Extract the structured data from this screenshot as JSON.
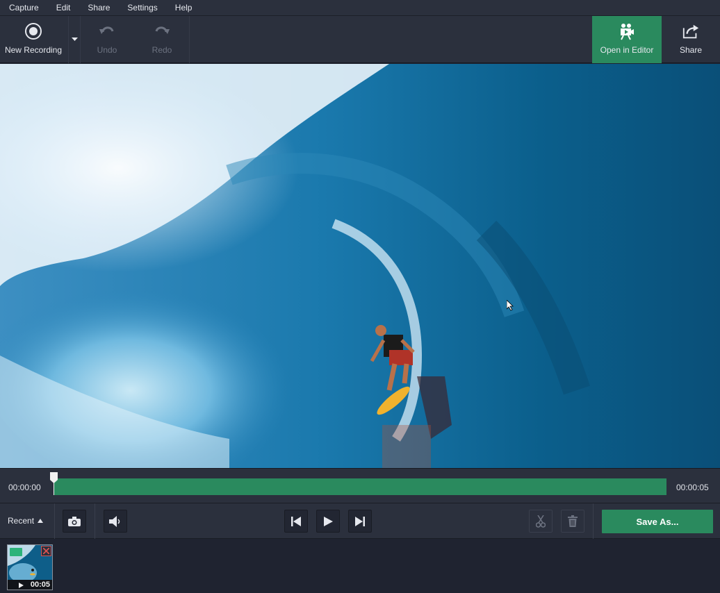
{
  "menu": [
    "Capture",
    "Edit",
    "Share",
    "Settings",
    "Help"
  ],
  "toolbar": {
    "new_recording": "New Recording",
    "undo": "Undo",
    "redo": "Redo",
    "open_in_editor": "Open in Editor",
    "share": "Share"
  },
  "timeline": {
    "start_time": "00:00:00",
    "end_time": "00:00:05",
    "playhead_fraction": 0.0
  },
  "controls": {
    "recent_label": "Recent",
    "save_as_label": "Save As..."
  },
  "recent_items": [
    {
      "duration": "00:05"
    }
  ],
  "colors": {
    "accent_green": "#2a8a5e",
    "panel_bg": "#2b303d",
    "app_bg": "#1f2330",
    "close_red": "#d9534f"
  },
  "icons": {
    "new_recording": "record-circle-icon",
    "undo": "undo-arrow-icon",
    "redo": "redo-arrow-icon",
    "open_in_editor": "film-camera-icon",
    "share": "share-box-icon",
    "screenshot": "camera-icon",
    "volume": "speaker-icon",
    "prev": "skip-back-icon",
    "play": "play-icon",
    "next": "skip-forward-icon",
    "cut": "scissors-icon",
    "delete": "trash-icon"
  }
}
